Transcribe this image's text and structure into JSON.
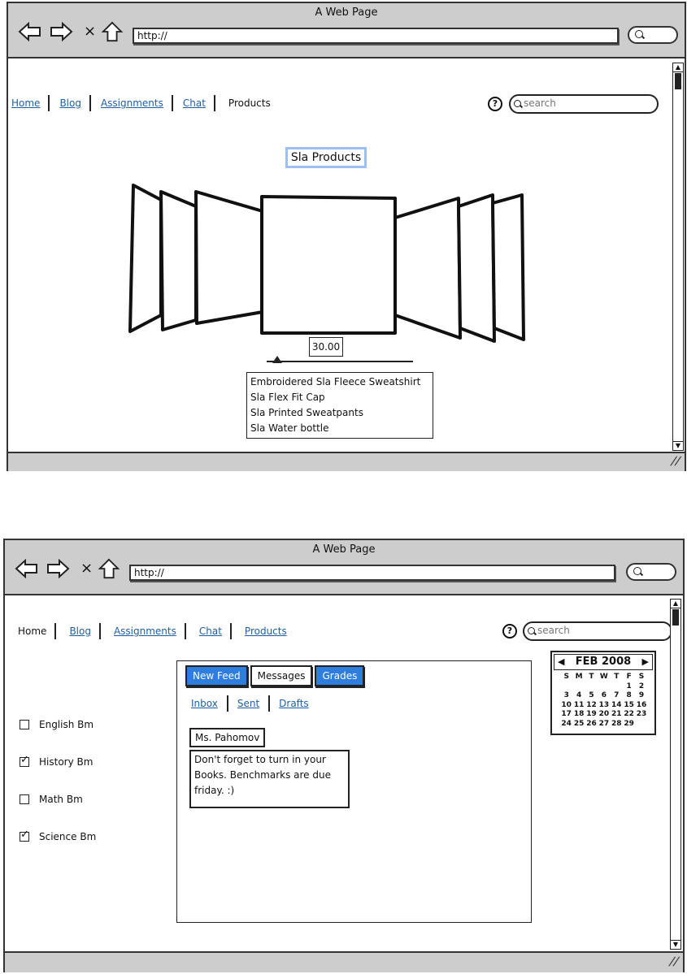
{
  "screens": [
    {
      "window_title": "A Web Page",
      "url": "http://",
      "nav": [
        {
          "label": "Home",
          "current": false
        },
        {
          "label": "Blog",
          "current": false
        },
        {
          "label": "Assignments",
          "current": false
        },
        {
          "label": "Chat",
          "current": false
        },
        {
          "label": "Products",
          "current": true
        }
      ],
      "help_icon": "?",
      "search_placeholder": "search",
      "products": {
        "title": "Sla Products",
        "price": "30.00",
        "slider_value_fraction": 0.05,
        "items": [
          "Embroidered Sla Fleece Sweatshirt",
          "Sla Flex Fit Cap",
          "Sla Printed Sweatpants",
          "Sla Water bottle"
        ]
      }
    },
    {
      "window_title": "A Web Page",
      "url": "http://",
      "nav": [
        {
          "label": "Home",
          "current": true
        },
        {
          "label": "Blog",
          "current": false
        },
        {
          "label": "Assignments",
          "current": false
        },
        {
          "label": "Chat",
          "current": false
        },
        {
          "label": "Products",
          "current": false
        }
      ],
      "help_icon": "?",
      "search_placeholder": "search",
      "checklist": [
        {
          "label": "English Bm",
          "checked": false
        },
        {
          "label": "History Bm",
          "checked": true
        },
        {
          "label": "Math Bm",
          "checked": false
        },
        {
          "label": "Science Bm",
          "checked": true
        }
      ],
      "tabs": [
        {
          "label": "New Feed",
          "active": true
        },
        {
          "label": "Messages",
          "active": false
        },
        {
          "label": "Grades",
          "active": true
        }
      ],
      "subnav": [
        "Inbox",
        "Sent",
        "Drafts"
      ],
      "message": {
        "sender": "Ms. Pahomov",
        "text": "Don't forget to turn in your Books. Benchmarks are due friday. :)"
      },
      "calendar": {
        "prev": "◀",
        "next": "▶",
        "month_label": "FEB 2008",
        "weekdays": [
          "S",
          "M",
          "T",
          "W",
          "T",
          "F",
          "S"
        ],
        "weeks": [
          [
            "",
            "",
            "",
            "",
            "",
            "1",
            "2"
          ],
          [
            "3",
            "4",
            "5",
            "6",
            "7",
            "8",
            "9"
          ],
          [
            "10",
            "11",
            "12",
            "13",
            "14",
            "15",
            "16"
          ],
          [
            "17",
            "18",
            "19",
            "20",
            "21",
            "22",
            "23"
          ],
          [
            "24",
            "25",
            "26",
            "27",
            "28",
            "29",
            ""
          ]
        ]
      }
    }
  ],
  "colors": {
    "chrome_gray": "#cdcdcd",
    "link_blue": "#1f5fa6",
    "tab_blue": "#2f7de0",
    "title_highlight": "#9ec0f0"
  }
}
